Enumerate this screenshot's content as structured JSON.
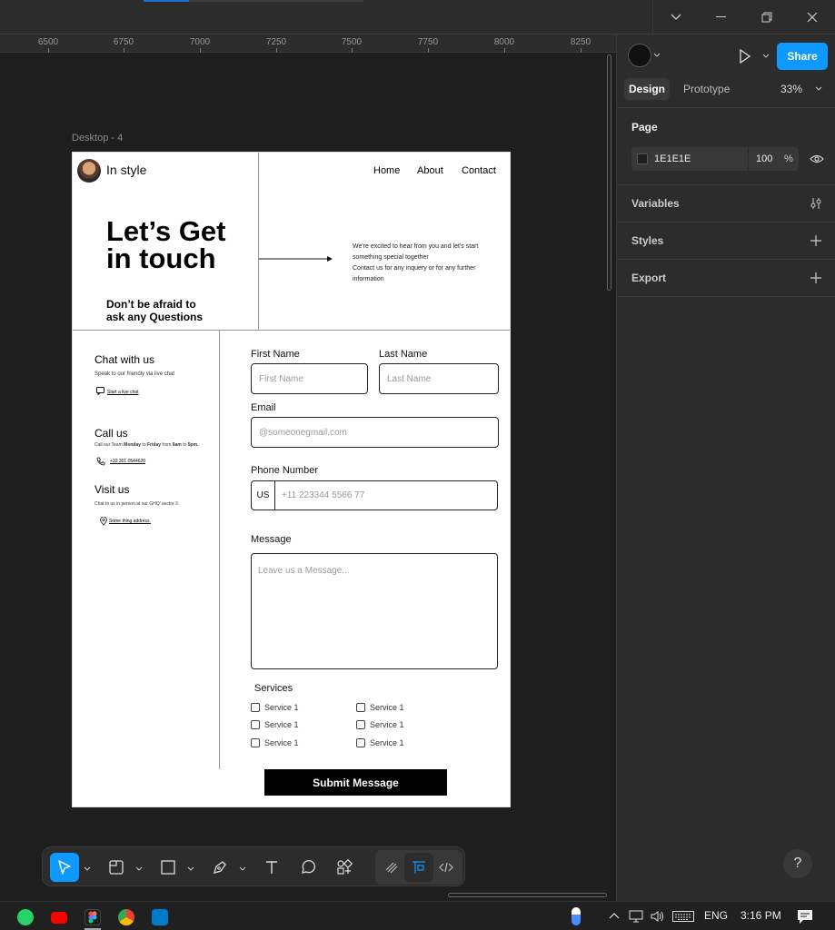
{
  "ruler": {
    "ticks": [
      "6500",
      "6750",
      "7000",
      "7250",
      "7500",
      "7750",
      "8000",
      "8250"
    ]
  },
  "frame": {
    "label": "Desktop - 4",
    "logo_text": "In style",
    "nav": [
      "Home",
      "About",
      "Contact"
    ],
    "hero_title_1": "Let’s Get",
    "hero_title_2": "in touch",
    "hero_sub_1": "Don’t be afraid to",
    "hero_sub_2": "ask any Questions",
    "intro_1": "We're excited to hear from you and let's start",
    "intro_2": "something special together",
    "intro_3": "Contact us for any inquery or for any further",
    "intro_4": "information",
    "chat_title": "Chat with us",
    "chat_desc": "Speak to our friendly via live chat",
    "chat_link": "Start a live chat",
    "call_title": "Call us",
    "call_desc_a": "Call our Team ",
    "call_desc_b": "Monday",
    "call_desc_c": " to ",
    "call_desc_d": "Friday",
    "call_desc_e": " from ",
    "call_desc_f": "9am",
    "call_desc_g": " to ",
    "call_desc_h": "5pm.",
    "call_link": "+32 301 0544620",
    "visit_title": "Visit us",
    "visit_desc": "Chat to us in person at our GHQ' sector 3.",
    "visit_link": "Some thing address.",
    "first_name_label": "First Name",
    "first_name_ph": "First Name",
    "last_name_label": "Last Name",
    "last_name_ph": "Last Name",
    "email_label": "Email",
    "email_ph": "@someonegmail.com",
    "phone_label": "Phone Number",
    "phone_country": "US",
    "phone_ph": "+11 223344 5566 77",
    "message_label": "Message",
    "message_ph": "Leave us a Message...",
    "services_label": "Services",
    "services": [
      "Service 1",
      "Service 1",
      "Service 1",
      "Service 1",
      "Service 1",
      "Service 1"
    ],
    "submit": "Submit Message"
  },
  "right_panel": {
    "share": "Share",
    "tab_design": "Design",
    "tab_prototype": "Prototype",
    "zoom": "33%",
    "page_title": "Page",
    "page_color": "1E1E1E",
    "page_opacity": "100",
    "percent": "%",
    "variables": "Variables",
    "styles": "Styles",
    "export": "Export"
  },
  "help": "?",
  "taskbar": {
    "lang": "ENG",
    "time": "3:16 PM"
  },
  "colors": {
    "accent": "#0d99ff",
    "canvas": "#1e1e1e",
    "panel": "#2c2c2c"
  }
}
